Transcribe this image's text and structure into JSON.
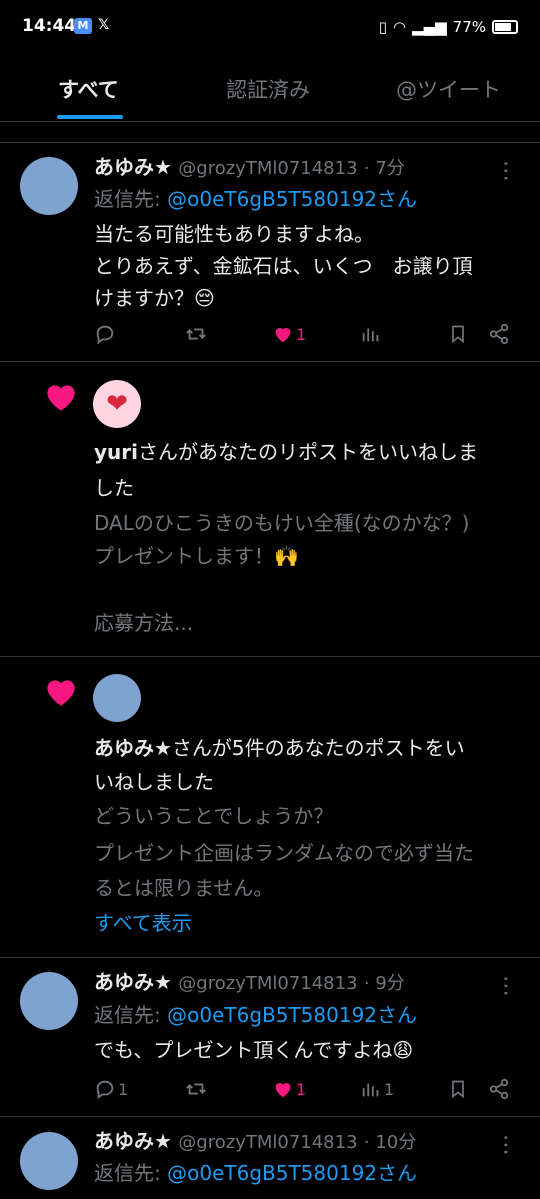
{
  "status": {
    "time": "14:44",
    "mail_icon": "gmail-icon",
    "x_icon": "x-icon",
    "battery": "77%"
  },
  "tabs": [
    {
      "label": "すべて",
      "active": true
    },
    {
      "label": "認証済み",
      "active": false
    },
    {
      "label": "@ツイート",
      "active": false
    }
  ],
  "tweets": [
    {
      "name": "あゆみ★",
      "handle": "@grozyTMl0714813",
      "time": "· 7分",
      "reply_prefix": "返信先:",
      "reply_to": "@o0eT6gB5T580192さん",
      "lines": [
        "当たる可能性もありますよね。",
        "とりあえず、金鉱石は、いくつ　お譲り頂",
        "けますか？😔"
      ],
      "replies": "",
      "likes": "1",
      "views": ""
    },
    {
      "name": "あゆみ★",
      "handle": "@grozyTMl0714813",
      "time": "· 9分",
      "reply_prefix": "返信先:",
      "reply_to": "@o0eT6gB5T580192さん",
      "lines": [
        "でも、プレゼント頂くんですよね😩"
      ],
      "replies": "1",
      "likes": "1",
      "views": "1"
    },
    {
      "name": "あゆみ★",
      "handle": "@grozyTMl0714813",
      "time": "· 10分",
      "reply_prefix": "返信先:",
      "reply_to": "@o0eT6gB5T580192さん"
    }
  ],
  "notifications": [
    {
      "avatar_glyph": "❤",
      "actor": "yuri",
      "action_line1": "さんがあなたのリポストをいいねしま",
      "action_line2": "した",
      "preview": [
        "DALのひこうきのもけい全種(なのかな？)",
        "プレゼントします！🙌",
        "",
        "応募方法..."
      ]
    },
    {
      "actor": "あゆみ★",
      "action_line1": "さんが5件のあなたのポストをい",
      "action_line2": "いねしました",
      "preview": [
        "どういうことでしょうか？",
        "プレゼント企画はランダムなので必ず当た",
        "るとは限りません。"
      ],
      "show_all": "すべて表示"
    }
  ],
  "colors": {
    "accent": "#1d9bf0",
    "like": "#f91880",
    "muted": "#71767b",
    "text": "#e7e9ea",
    "background": "#000000"
  }
}
